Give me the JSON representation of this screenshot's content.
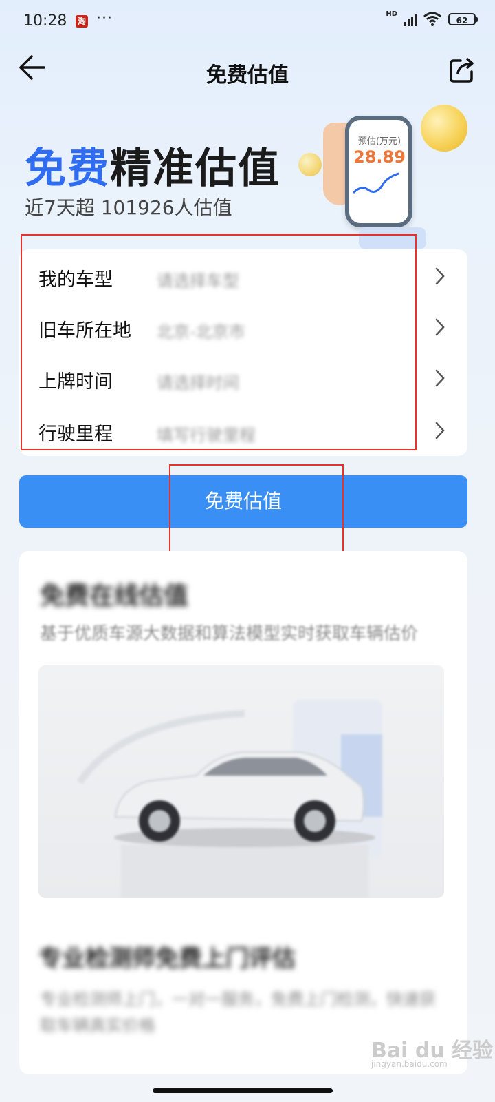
{
  "status_bar": {
    "time": "10:28",
    "app_badge": "淘",
    "dots": "···",
    "network": "HD",
    "battery": "62"
  },
  "nav": {
    "title": "免费估值"
  },
  "hero": {
    "title_highlight": "免费",
    "title_rest": "精准估值",
    "subtitle": "近7天超 101926人估值",
    "phone_label": "预估(万元)",
    "phone_value": "28.89"
  },
  "form": {
    "rows": [
      {
        "label": "我的车型",
        "value": "请选择车型"
      },
      {
        "label": "旧车所在地",
        "value": "北京-北京市"
      },
      {
        "label": "上牌时间",
        "value": "请选择时间"
      },
      {
        "label": "行驶里程",
        "value": "填写行驶里程"
      }
    ]
  },
  "cta": {
    "label": "免费估值"
  },
  "info": {
    "title": "免费在线估值",
    "description": "基于优质车源大数据和算法模型实时获取车辆估价",
    "expert_title": "专业检测师免费上门评估",
    "expert_description": "专业检测师上门，一对一服务，免费上门检测，快速获取车辆真实价格"
  },
  "watermark": {
    "brand": "Bai du 经验",
    "url": "jingyan.baidu.com"
  },
  "colors": {
    "accent_blue": "#2f6cf0",
    "cta_blue": "#3a8ff5",
    "highlight_red": "#e5322b",
    "value_orange": "#f0773a"
  }
}
